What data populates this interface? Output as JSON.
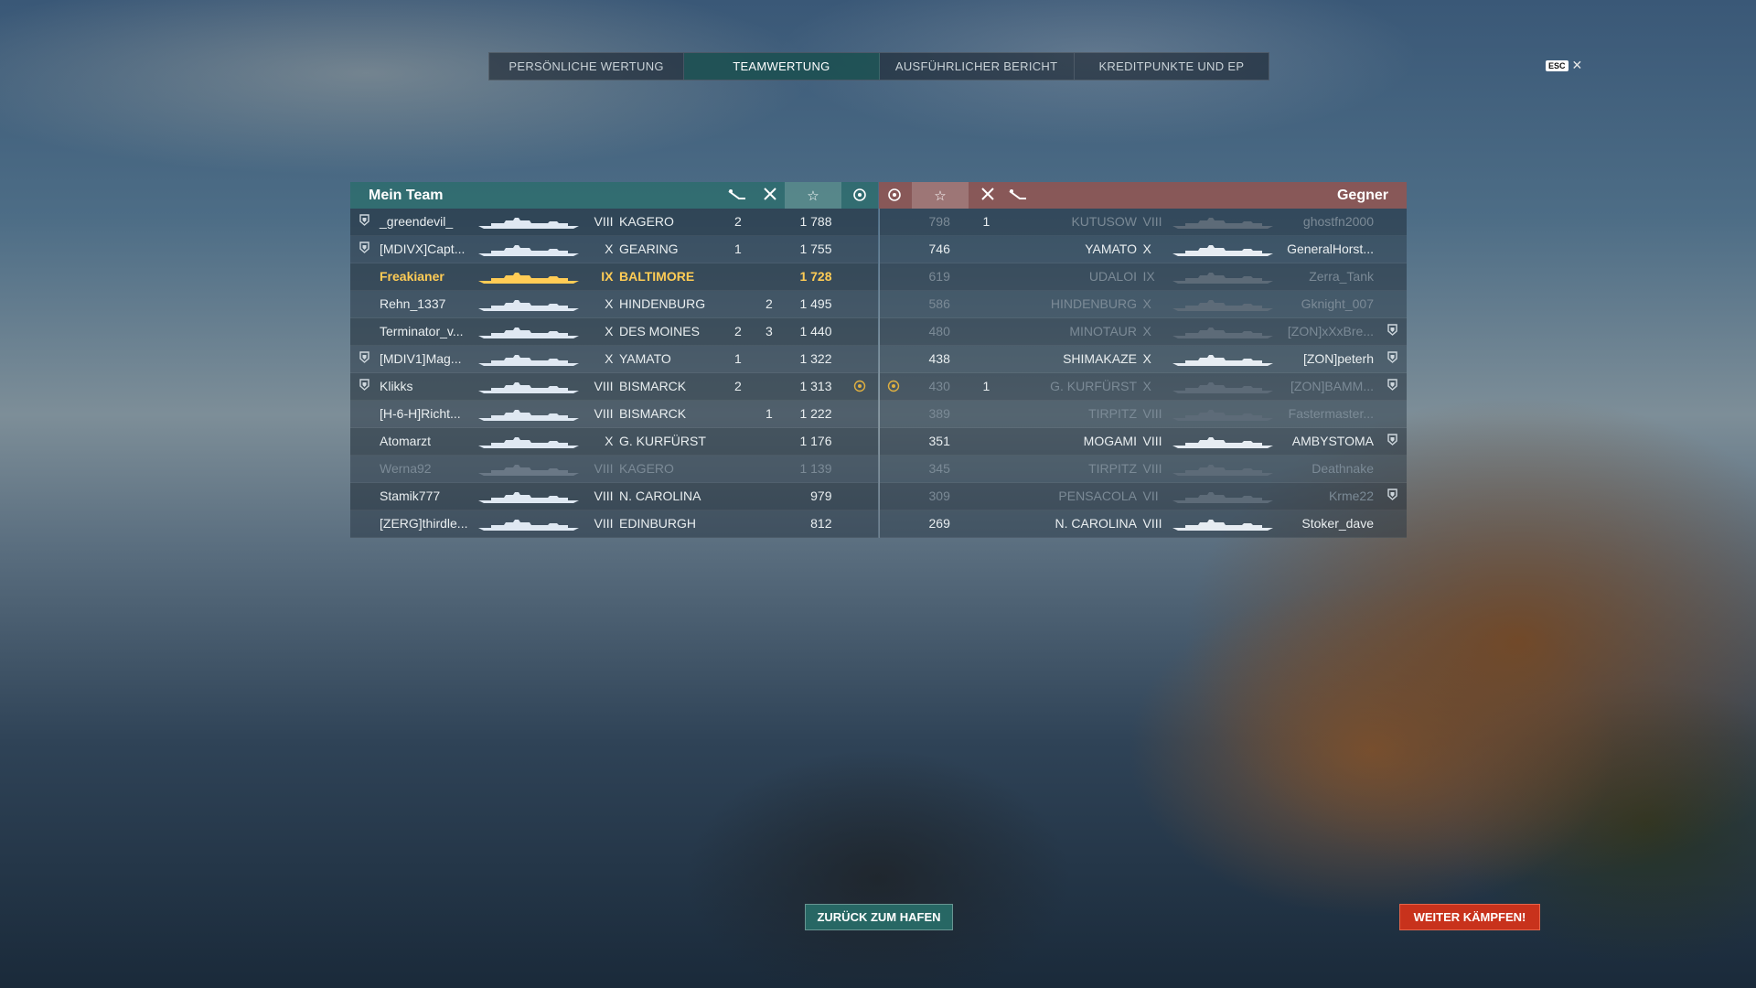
{
  "tabs": [
    "PERSÖNLICHE WERTUNG",
    "TEAMWERTUNG",
    "AUSFÜHRLICHER BERICHT",
    "KREDITPUNKTE UND EP"
  ],
  "esc": {
    "label": "ESC",
    "close": "✕"
  },
  "my_team": {
    "title": "Mein Team",
    "rows": [
      {
        "player": "_greendevil_",
        "tier": "VIII",
        "ship": "KAGERO",
        "c1": "2",
        "c2": "",
        "score": "1 788",
        "medal": false,
        "badge": true,
        "state": "alive"
      },
      {
        "player": "[MDIVX]Capt...",
        "tier": "X",
        "ship": "GEARING",
        "c1": "1",
        "c2": "",
        "score": "1 755",
        "medal": false,
        "badge": true,
        "state": "alive"
      },
      {
        "player": "Freakianer",
        "tier": "IX",
        "ship": "BALTIMORE",
        "c1": "",
        "c2": "",
        "score": "1 728",
        "medal": false,
        "badge": false,
        "state": "self"
      },
      {
        "player": "Rehn_1337",
        "tier": "X",
        "ship": "HINDENBURG",
        "c1": "",
        "c2": "2",
        "score": "1 495",
        "medal": false,
        "badge": false,
        "state": "alive"
      },
      {
        "player": "Terminator_v...",
        "tier": "X",
        "ship": "DES MOINES",
        "c1": "2",
        "c2": "3",
        "score": "1 440",
        "medal": false,
        "badge": false,
        "state": "alive"
      },
      {
        "player": "[MDIV1]Mag...",
        "tier": "X",
        "ship": "YAMATO",
        "c1": "1",
        "c2": "",
        "score": "1 322",
        "medal": false,
        "badge": true,
        "state": "alive"
      },
      {
        "player": "Klikks",
        "tier": "VIII",
        "ship": "BISMARCK",
        "c1": "2",
        "c2": "",
        "score": "1 313",
        "medal": true,
        "badge": true,
        "state": "alive"
      },
      {
        "player": "[H-6-H]Richt...",
        "tier": "VIII",
        "ship": "BISMARCK",
        "c1": "",
        "c2": "1",
        "score": "1 222",
        "medal": false,
        "badge": false,
        "state": "alive"
      },
      {
        "player": "Atomarzt",
        "tier": "X",
        "ship": "G. KURFÜRST",
        "c1": "",
        "c2": "",
        "score": "1 176",
        "medal": false,
        "badge": false,
        "state": "alive"
      },
      {
        "player": "Werna92",
        "tier": "VIII",
        "ship": "KAGERO",
        "c1": "",
        "c2": "",
        "score": "1 139",
        "medal": false,
        "badge": false,
        "state": "dead"
      },
      {
        "player": "Stamik777",
        "tier": "VIII",
        "ship": "N. CAROLINA",
        "c1": "",
        "c2": "",
        "score": "979",
        "medal": false,
        "badge": false,
        "state": "alive"
      },
      {
        "player": "[ZERG]thirdle...",
        "tier": "VIII",
        "ship": "EDINBURGH",
        "c1": "",
        "c2": "",
        "score": "812",
        "medal": false,
        "badge": false,
        "state": "alive"
      }
    ]
  },
  "enemy": {
    "title": "Gegner",
    "rows": [
      {
        "player": "ghostfn2000",
        "tier": "VIII",
        "ship": "KUTUSOW",
        "c1": "1",
        "c2": "",
        "score": "798",
        "medal": false,
        "badge": false,
        "state": "dead"
      },
      {
        "player": "GeneralHorst...",
        "tier": "X",
        "ship": "YAMATO",
        "c1": "",
        "c2": "",
        "score": "746",
        "medal": false,
        "badge": false,
        "state": "alive"
      },
      {
        "player": "Zerra_Tank",
        "tier": "IX",
        "ship": "UDALOI",
        "c1": "",
        "c2": "",
        "score": "619",
        "medal": false,
        "badge": false,
        "state": "dead"
      },
      {
        "player": "Gknight_007",
        "tier": "X",
        "ship": "HINDENBURG",
        "c1": "",
        "c2": "",
        "score": "586",
        "medal": false,
        "badge": false,
        "state": "dead"
      },
      {
        "player": "[ZON]xXxBre...",
        "tier": "X",
        "ship": "MINOTAUR",
        "c1": "",
        "c2": "",
        "score": "480",
        "medal": false,
        "badge": true,
        "state": "dead"
      },
      {
        "player": "[ZON]peterh",
        "tier": "X",
        "ship": "SHIMAKAZE",
        "c1": "",
        "c2": "",
        "score": "438",
        "medal": false,
        "badge": true,
        "state": "alive"
      },
      {
        "player": "[ZON]BAMM...",
        "tier": "X",
        "ship": "G. KURFÜRST",
        "c1": "1",
        "c2": "",
        "score": "430",
        "medal": true,
        "badge": true,
        "state": "dead"
      },
      {
        "player": "Fastermaster...",
        "tier": "VIII",
        "ship": "TIRPITZ",
        "c1": "",
        "c2": "",
        "score": "389",
        "medal": false,
        "badge": false,
        "state": "dead"
      },
      {
        "player": "AMBYSTOMA",
        "tier": "VIII",
        "ship": "MOGAMI",
        "c1": "",
        "c2": "",
        "score": "351",
        "medal": false,
        "badge": true,
        "state": "alive"
      },
      {
        "player": "Deathnake",
        "tier": "VIII",
        "ship": "TIRPITZ",
        "c1": "",
        "c2": "",
        "score": "345",
        "medal": false,
        "badge": false,
        "state": "dead"
      },
      {
        "player": "Krme22",
        "tier": "VII",
        "ship": "PENSACOLA",
        "c1": "",
        "c2": "",
        "score": "309",
        "medal": false,
        "badge": true,
        "state": "dead"
      },
      {
        "player": "Stoker_dave",
        "tier": "VIII",
        "ship": "N. CAROLINA",
        "c1": "",
        "c2": "",
        "score": "269",
        "medal": false,
        "badge": false,
        "state": "alive"
      }
    ]
  },
  "buttons": {
    "home": "ZURÜCK ZUM HAFEN",
    "fight": "WEITER KÄMPFEN!"
  },
  "colors": {
    "self": "#ffcc55",
    "dead": "#7b8a96",
    "alive": "#e9eef0",
    "team_header": "#286e69",
    "enemy_header": "#a05046",
    "fight_button": "#c8321c"
  },
  "header_icons": [
    "torpedo-hit-icon",
    "kill-icon",
    "star-icon",
    "medal-icon"
  ]
}
